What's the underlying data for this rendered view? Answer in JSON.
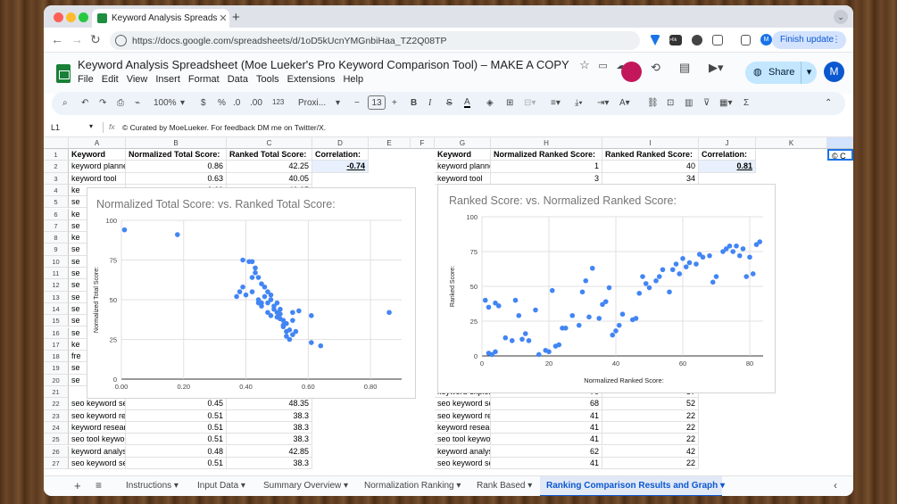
{
  "browser": {
    "tab_title": "Keyword Analysis Spreadsheet",
    "url": "https://docs.google.com/spreadsheets/d/1oD5kUcnYMGnbiHaa_TZ2Q08TP",
    "finish_update": "Finish update",
    "ext_badge": ">6k",
    "profile_letter": "M"
  },
  "doc": {
    "title": "Keyword Analysis Spreadsheet (Moe Lueker's Pro Keyword Comparison Tool) – MAKE A COPY",
    "menus": [
      "File",
      "Edit",
      "View",
      "Insert",
      "Format",
      "Data",
      "Tools",
      "Extensions",
      "Help"
    ],
    "share_label": "Share",
    "avatar": "M"
  },
  "toolbar": {
    "zoom": "100%",
    "currency": "$",
    "percent": "%",
    "dec_dec": ".0",
    "inc_dec": ".00",
    "num_fmt": "123",
    "font": "Proxi...",
    "font_size": "13"
  },
  "formula": {
    "cell_ref": "L1",
    "fx": "fx",
    "content": "© Curated by MoeLueker. For feedback DM me on Twitter/X."
  },
  "columns": [
    "A",
    "B",
    "C",
    "D",
    "E",
    "F",
    "G",
    "H",
    "I",
    "J",
    "K"
  ],
  "rows": [
    "1",
    "2",
    "3",
    "4",
    "5",
    "6",
    "7",
    "8",
    "9",
    "10",
    "11",
    "12",
    "13",
    "14",
    "15",
    "16",
    "17",
    "18",
    "19",
    "20",
    "21",
    "22",
    "23",
    "24",
    "25",
    "26",
    "27"
  ],
  "header_row": {
    "a": "Keyword",
    "b": "Normalized Total Score:",
    "c": "Ranked Total Score:",
    "d": "Correlation:",
    "g": "Keyword",
    "h": "Normalized Ranked Score:",
    "i": "Ranked Ranked Score:",
    "j": "Correlation:",
    "l": "© C"
  },
  "row2": {
    "a": "keyword planner",
    "b": "0.86",
    "c": "42.25",
    "d": "-0.74",
    "g": "keyword planner",
    "h": "1",
    "i": "40",
    "j": "0.81"
  },
  "row3": {
    "a": "keyword tool",
    "b": "0.63",
    "c": "40.05",
    "g": "keyword tool",
    "h": "3",
    "i": "34"
  },
  "row4": {
    "a": "ke",
    "b": "0.60",
    "c": "40.05"
  },
  "left_partial": [
    "se",
    "ke",
    "se",
    "ke",
    "se",
    "se",
    "se",
    "se",
    "se",
    "se",
    "se",
    "se",
    "ke",
    "fre",
    "se",
    "se"
  ],
  "right_partial_row21": {
    "g": "keyword explore",
    "h": "70",
    "i": "57"
  },
  "lower_rows": [
    {
      "a": "seo keyword sea",
      "b": "0.45",
      "c": "48.35",
      "g": "seo keyword sea",
      "h": "68",
      "i": "52"
    },
    {
      "a": "seo keyword res",
      "b": "0.51",
      "c": "38.3",
      "g": "seo keyword res",
      "h": "41",
      "i": "22"
    },
    {
      "a": "keyword researc",
      "b": "0.51",
      "c": "38.3",
      "g": "keyword researc",
      "h": "41",
      "i": "22"
    },
    {
      "a": "seo tool keywor",
      "b": "0.51",
      "c": "38.3",
      "g": "seo tool keywor",
      "h": "41",
      "i": "22"
    },
    {
      "a": "keyword analysis",
      "b": "0.48",
      "c": "42.85",
      "g": "keyword analysis",
      "h": "62",
      "i": "42"
    },
    {
      "a": "seo keyword sea",
      "b": "0.51",
      "c": "38.3",
      "g": "seo keyword sea",
      "h": "41",
      "i": "22"
    }
  ],
  "sheet_tabs": [
    "Instructions",
    "Input Data",
    "Summary Overview",
    "Normalization Ranking",
    "Rank Based",
    "Ranking Comparison Results and Graph"
  ],
  "chart_data": [
    {
      "type": "scatter",
      "title": "Normalized Total Score: vs. Ranked Total Score:",
      "xlabel": "",
      "ylabel": "Normalized Total Score:",
      "xlim": [
        0,
        0.9
      ],
      "ylim": [
        0,
        100
      ],
      "xticks": [
        "0.00",
        "0.20",
        "0.40",
        "0.60",
        "0.80"
      ],
      "yticks": [
        "0",
        "25",
        "50",
        "75",
        "100"
      ],
      "color": "#4285f4",
      "points": [
        [
          0.01,
          94
        ],
        [
          0.18,
          91
        ],
        [
          0.86,
          42
        ],
        [
          0.39,
          75
        ],
        [
          0.41,
          74
        ],
        [
          0.42,
          74
        ],
        [
          0.43,
          70
        ],
        [
          0.43,
          67
        ],
        [
          0.42,
          64
        ],
        [
          0.44,
          64
        ],
        [
          0.45,
          60
        ],
        [
          0.46,
          58
        ],
        [
          0.47,
          55
        ],
        [
          0.37,
          52
        ],
        [
          0.38,
          55
        ],
        [
          0.39,
          58
        ],
        [
          0.4,
          53
        ],
        [
          0.42,
          55
        ],
        [
          0.44,
          50
        ],
        [
          0.45,
          48
        ],
        [
          0.46,
          52
        ],
        [
          0.47,
          48
        ],
        [
          0.48,
          53
        ],
        [
          0.48,
          50
        ],
        [
          0.49,
          46
        ],
        [
          0.49,
          44
        ],
        [
          0.5,
          48
        ],
        [
          0.5,
          42
        ],
        [
          0.5,
          39
        ],
        [
          0.51,
          44
        ],
        [
          0.51,
          41
        ],
        [
          0.51,
          38
        ],
        [
          0.52,
          37
        ],
        [
          0.52,
          34
        ],
        [
          0.52,
          33
        ],
        [
          0.53,
          30
        ],
        [
          0.53,
          27
        ],
        [
          0.54,
          25
        ],
        [
          0.55,
          37
        ],
        [
          0.55,
          42
        ],
        [
          0.56,
          30
        ],
        [
          0.57,
          43
        ],
        [
          0.61,
          40
        ],
        [
          0.61,
          23
        ],
        [
          0.64,
          21
        ],
        [
          0.47,
          42
        ],
        [
          0.48,
          40
        ],
        [
          0.44,
          48
        ],
        [
          0.45,
          46
        ],
        [
          0.53,
          35
        ],
        [
          0.54,
          31
        ],
        [
          0.55,
          28
        ]
      ]
    },
    {
      "type": "scatter",
      "title": "Ranked Score: vs. Normalized Ranked Score:",
      "xlabel": "Normalized Ranked Score:",
      "ylabel": "Ranked Score:",
      "xlim": [
        0,
        84
      ],
      "ylim": [
        0,
        100
      ],
      "xticks": [
        "0",
        "20",
        "40",
        "60",
        "80"
      ],
      "yticks": [
        "0",
        "25",
        "50",
        "75",
        "100"
      ],
      "color": "#4285f4",
      "points": [
        [
          1,
          40
        ],
        [
          2,
          35
        ],
        [
          4,
          38
        ],
        [
          5,
          36
        ],
        [
          7,
          13
        ],
        [
          9,
          11
        ],
        [
          10,
          40
        ],
        [
          11,
          29
        ],
        [
          12,
          12
        ],
        [
          13,
          16
        ],
        [
          14,
          11
        ],
        [
          3,
          1
        ],
        [
          2,
          2
        ],
        [
          4,
          3
        ],
        [
          16,
          33
        ],
        [
          17,
          1
        ],
        [
          19,
          4
        ],
        [
          20,
          3
        ],
        [
          21,
          47
        ],
        [
          22,
          7
        ],
        [
          23,
          8
        ],
        [
          24,
          20
        ],
        [
          25,
          20
        ],
        [
          27,
          29
        ],
        [
          29,
          22
        ],
        [
          30,
          46
        ],
        [
          31,
          54
        ],
        [
          32,
          28
        ],
        [
          33,
          63
        ],
        [
          35,
          27
        ],
        [
          36,
          37
        ],
        [
          37,
          39
        ],
        [
          38,
          49
        ],
        [
          39,
          15
        ],
        [
          40,
          18
        ],
        [
          41,
          22
        ],
        [
          42,
          30
        ],
        [
          45,
          26
        ],
        [
          46,
          27
        ],
        [
          47,
          45
        ],
        [
          48,
          57
        ],
        [
          49,
          52
        ],
        [
          50,
          49
        ],
        [
          52,
          54
        ],
        [
          53,
          57
        ],
        [
          54,
          62
        ],
        [
          56,
          46
        ],
        [
          57,
          62
        ],
        [
          58,
          66
        ],
        [
          59,
          59
        ],
        [
          60,
          70
        ],
        [
          61,
          64
        ],
        [
          62,
          67
        ],
        [
          64,
          66
        ],
        [
          65,
          73
        ],
        [
          66,
          71
        ],
        [
          68,
          72
        ],
        [
          69,
          53
        ],
        [
          70,
          57
        ],
        [
          72,
          75
        ],
        [
          73,
          77
        ],
        [
          74,
          79
        ],
        [
          75,
          75
        ],
        [
          76,
          79
        ],
        [
          77,
          72
        ],
        [
          78,
          77
        ],
        [
          79,
          57
        ],
        [
          80,
          71
        ],
        [
          81,
          59
        ],
        [
          82,
          80
        ],
        [
          83,
          82
        ]
      ]
    }
  ]
}
